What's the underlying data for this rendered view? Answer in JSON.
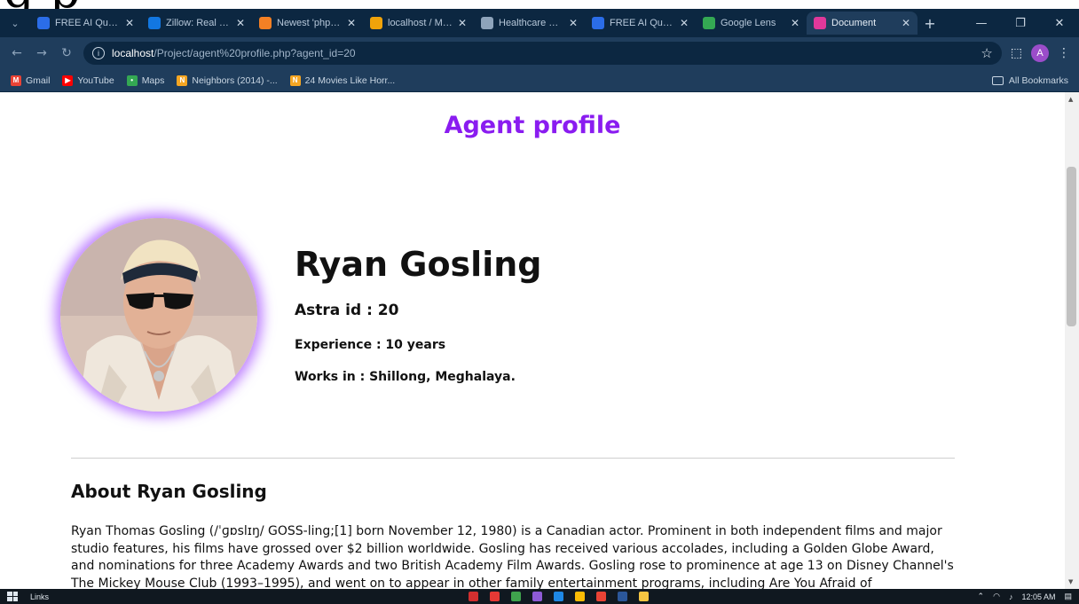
{
  "page_overflow_text": "g p",
  "tabs": [
    {
      "label": "FREE AI Question",
      "icon": "lightning-icon",
      "color": "#2b6de8"
    },
    {
      "label": "Zillow: Real Estate",
      "icon": "zillow-icon",
      "color": "#1277e1"
    },
    {
      "label": "Newest 'php' Qu",
      "icon": "stackoverflow-icon",
      "color": "#f48024"
    },
    {
      "label": "localhost / MySQ",
      "icon": "phpmyadmin-icon",
      "color": "#f0a30a"
    },
    {
      "label": "Healthcare Chatb",
      "icon": "globe-icon",
      "color": "#8ea4bb"
    },
    {
      "label": "FREE AI Question",
      "icon": "lightning-icon",
      "color": "#2b6de8"
    },
    {
      "label": "Google Lens",
      "icon": "lens-icon",
      "color": "#34a853"
    },
    {
      "label": "Document",
      "icon": "document-icon",
      "color": "#e0389a"
    }
  ],
  "address_bar": {
    "host": "localhost",
    "path": "/Project/agent%20profile.php?agent_id=20"
  },
  "bookmarks": [
    {
      "label": "Gmail",
      "color": "#ea4335",
      "glyph": "M"
    },
    {
      "label": "YouTube",
      "color": "#ff0000",
      "glyph": "▶"
    },
    {
      "label": "Maps",
      "color": "#34a853",
      "glyph": "•"
    },
    {
      "label": "Neighbors (2014) -...",
      "color": "#f5a623",
      "glyph": "N"
    },
    {
      "label": "24 Movies Like Horr...",
      "color": "#f5a623",
      "glyph": "N"
    }
  ],
  "all_bookmarks_label": "All Bookmarks",
  "profile_initial": "A",
  "page": {
    "title": "Agent profile",
    "agent_name": "Ryan Gosling",
    "agent_id": "Astra id : 20",
    "experience": "Experience : 10 years",
    "location": "Works in : Shillong, Meghalaya.",
    "about_heading": "About Ryan Gosling",
    "about_text": "Ryan Thomas Gosling (/ˈɡɒslɪŋ/ GOSS-ling;[1] born November 12, 1980) is a Canadian actor. Prominent in both independent films and major studio features, his films have grossed over $2 billion worldwide. Gosling has received various accolades, including a Golden Globe Award, and nominations for three Academy Awards and two British Academy Film Awards. Gosling rose to prominence at age 13 on Disney Channel's The Mickey Mouse Club (1993–1995), and went on to appear in other family entertainment programs, including Are You Afraid of"
  },
  "colors": {
    "title_purple": "#8a1cf0",
    "avatar_glow": "#aa5aff",
    "chrome_dark": "#0c2741",
    "chrome_mid": "#1f3d5c"
  },
  "taskbar": {
    "links_label": "Links",
    "time": "12:05 AM"
  }
}
